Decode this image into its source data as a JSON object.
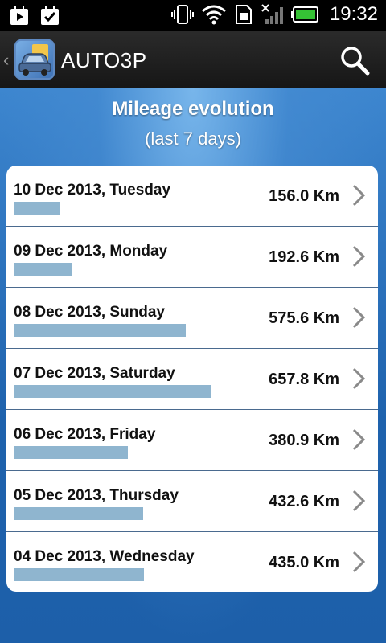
{
  "status_bar": {
    "time": "19:32"
  },
  "app": {
    "title": "AUTO3P"
  },
  "page": {
    "title": "Mileage evolution",
    "subtitle": "(last 7 days)"
  },
  "rows": [
    {
      "date": "10 Dec 2013, Tuesday",
      "value": "156.0 Km",
      "km": 156.0
    },
    {
      "date": "09 Dec 2013, Monday",
      "value": "192.6 Km",
      "km": 192.6
    },
    {
      "date": "08 Dec 2013, Sunday",
      "value": "575.6 Km",
      "km": 575.6
    },
    {
      "date": "07 Dec 2013, Saturday",
      "value": "657.8 Km",
      "km": 657.8
    },
    {
      "date": "06 Dec 2013, Friday",
      "value": "380.9 Km",
      "km": 380.9
    },
    {
      "date": "05 Dec 2013, Thursday",
      "value": "432.6 Km",
      "km": 432.6
    },
    {
      "date": "04 Dec 2013, Wednesday",
      "value": "435.0 Km",
      "km": 435.0
    }
  ],
  "colors": {
    "bar": "#8fb5cf",
    "background": "#1a5ca8",
    "battery": "#35c235"
  }
}
